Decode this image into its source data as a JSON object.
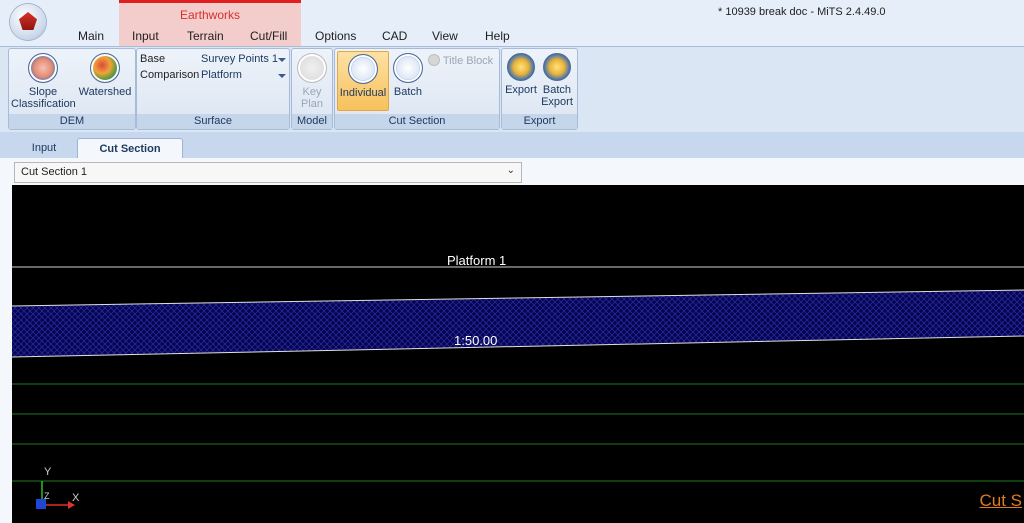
{
  "window_title": "* 10939 break doc - MiTS 2.4.49.0",
  "context_tab": "Earthworks",
  "menu": [
    "Main",
    "Input",
    "Terrain",
    "Cut/Fill",
    "Options",
    "CAD",
    "View",
    "Help"
  ],
  "ribbon": {
    "dem": {
      "label": "DEM",
      "slope_line1": "Slope",
      "slope_line2": "Classification",
      "watershed": "Watershed"
    },
    "surface": {
      "label": "Surface",
      "base_label": "Base",
      "base_value": "Survey Points 1",
      "comparison_label": "Comparison",
      "comparison_value": "Platform"
    },
    "model": {
      "label": "Model",
      "key_line1": "Key",
      "key_line2": "Plan"
    },
    "cut_section": {
      "label": "Cut Section",
      "individual": "Individual",
      "batch": "Batch",
      "title_block": "Title Block"
    },
    "export": {
      "label": "Export",
      "export": "Export",
      "batch_line1": "Batch",
      "batch_line2": "Export"
    }
  },
  "tabs": [
    "Input",
    "Cut Section"
  ],
  "active_tab": "Cut Section",
  "section_select": {
    "value": "Cut Section 1"
  },
  "canvas": {
    "platform_label": "Platform 1",
    "slope_label": "1:50.00",
    "axis_y": "Y",
    "axis_z": "Z",
    "axis_x": "X",
    "corner_link": "Cut S"
  },
  "colors": {
    "context_red": "#e21f1f",
    "hatch_fill": "#0a0a6e",
    "grid_green": "#1f7a1f",
    "link_orange": "#e07b1e"
  }
}
